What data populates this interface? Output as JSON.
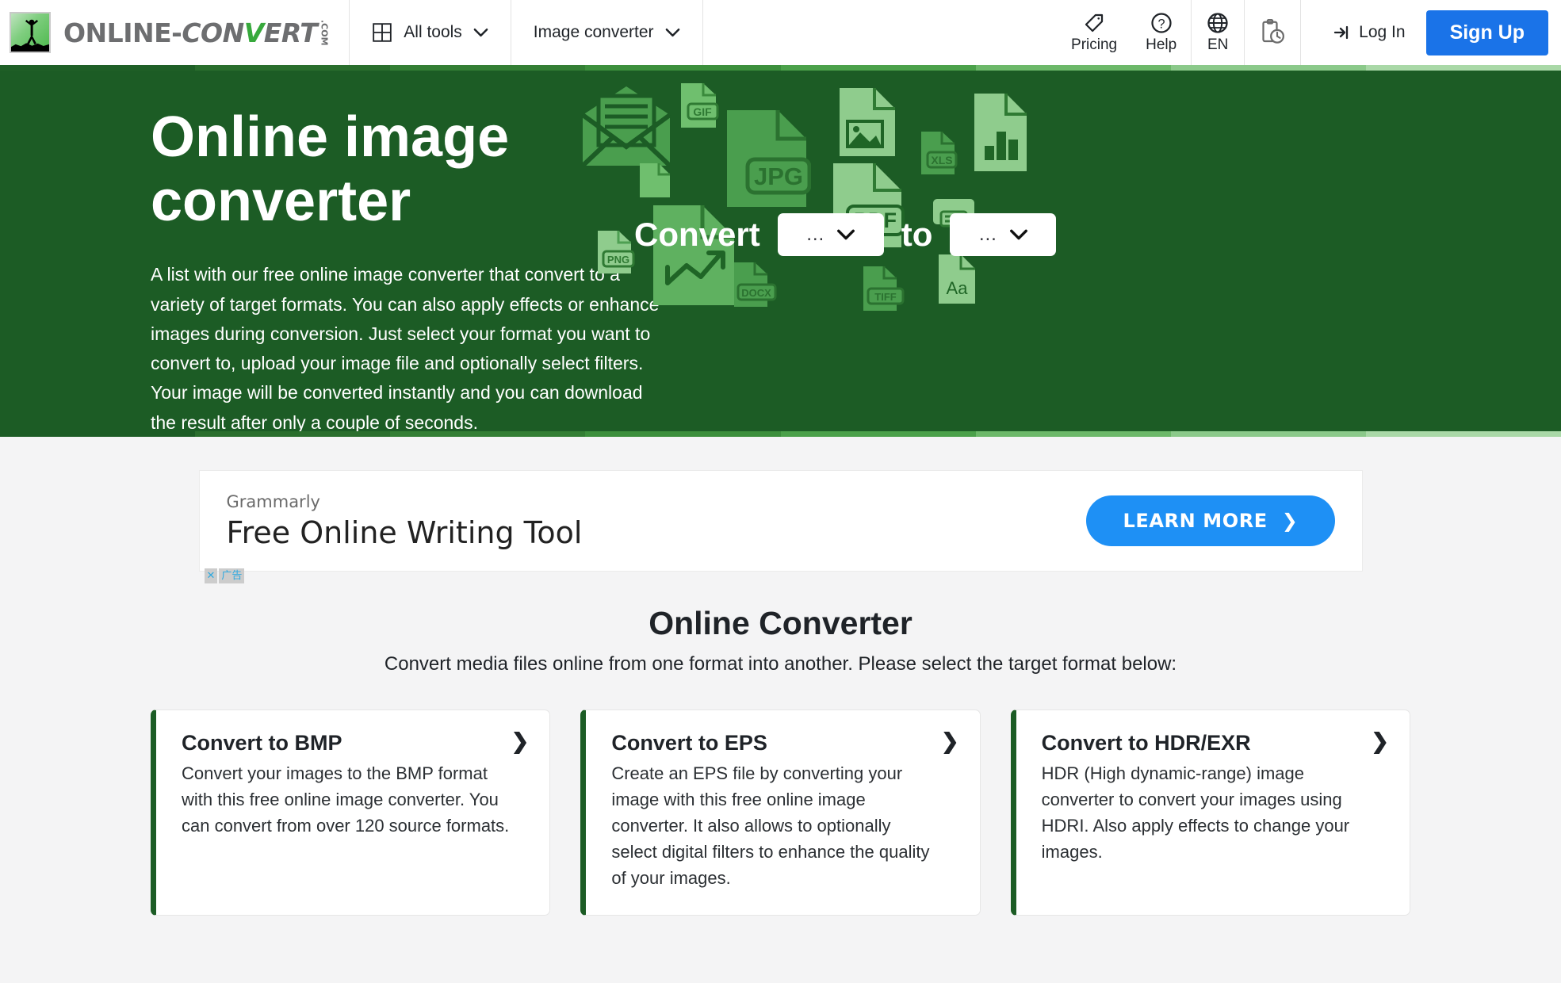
{
  "header": {
    "logo": {
      "part1": "ONLINE",
      "dash": "-",
      "part2": "CON",
      "part3": "V",
      "part4": "ERT",
      "domain": ".COM"
    },
    "nav": [
      {
        "label": "All tools",
        "icon": "grid-icon"
      },
      {
        "label": "Image converter",
        "icon": "chevron-down-icon"
      }
    ],
    "icons": [
      {
        "label": "Pricing",
        "icon": "tag-icon"
      },
      {
        "label": "Help",
        "icon": "question-circle-icon"
      },
      {
        "label": "EN",
        "icon": "globe-icon"
      },
      {
        "label": "",
        "icon": "clipboard-clock-icon"
      }
    ],
    "login_label": "Log In",
    "signup_label": "Sign Up",
    "accent_blue": "#1a73e8"
  },
  "hero": {
    "title": "Online image converter",
    "description": "A list with our free online image converter that convert to a variety of target formats. You can also apply effects or enhance images during conversion. Just select your format you want to convert to, upload your image file and optionally select filters. Your image will be converted instantly and you can download the result after only a couple of seconds.",
    "convert_label": "Convert",
    "to_label": "to",
    "source_format": "…",
    "target_format": "…",
    "bg_color": "#1c5c25",
    "file_badges": [
      "GIF",
      "JPG",
      "PDF",
      "XLS",
      "PNG",
      "DOCX",
      "TIFF",
      "Aa"
    ]
  },
  "ad": {
    "brand": "Grammarly",
    "headline": "Free Online Writing Tool",
    "cta": "LEARN MORE",
    "cta_arrow": "❯",
    "choices_close": "✕",
    "choices_label": "广告"
  },
  "section": {
    "title": "Online Converter",
    "subtitle": "Convert media files online from one format into another. Please select the target format below:",
    "accent_green": "#1c5c25"
  },
  "cards": [
    {
      "title": "Convert to BMP",
      "desc": "Convert your images to the BMP format with this free online image converter. You can convert from over 120 source formats.",
      "arrow": "❯"
    },
    {
      "title": "Convert to EPS",
      "desc": "Create an EPS file by converting your image with this free online image converter. It also allows to optionally select digital filters to enhance the quality of your images.",
      "arrow": "❯"
    },
    {
      "title": "Convert to HDR/EXR",
      "desc": "HDR (High dynamic-range) image converter to convert your images using HDRI. Also apply effects to change your images.",
      "arrow": "❯"
    }
  ]
}
